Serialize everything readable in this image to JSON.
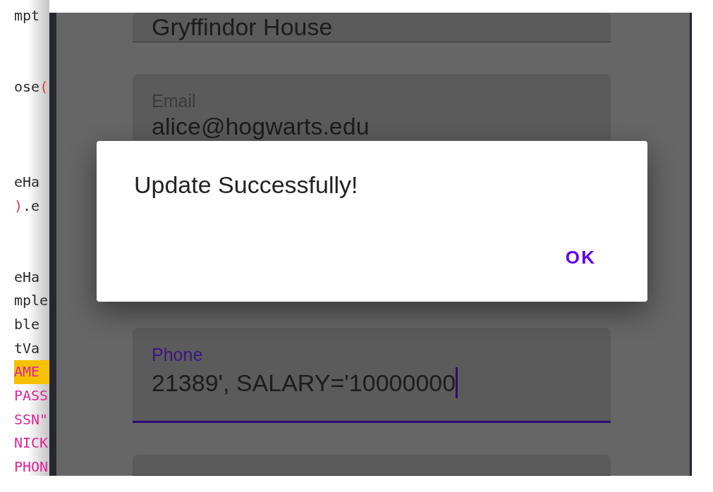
{
  "code_editor": {
    "lines": [
      {
        "kind": "code",
        "highlighted": false,
        "tokens": [
          {
            "kind": "plain",
            "text": "mpt"
          }
        ]
      },
      {
        "kind": "blank"
      },
      {
        "kind": "blank"
      },
      {
        "kind": "code",
        "highlighted": false,
        "tokens": [
          {
            "kind": "plain",
            "text": "ose"
          },
          {
            "kind": "punct",
            "text": "("
          }
        ]
      },
      {
        "kind": "blank"
      },
      {
        "kind": "blank"
      },
      {
        "kind": "blank"
      },
      {
        "kind": "code",
        "highlighted": false,
        "tokens": [
          {
            "kind": "plain",
            "text": "eHa"
          }
        ]
      },
      {
        "kind": "code",
        "highlighted": false,
        "tokens": [
          {
            "kind": "punct",
            "text": ")"
          },
          {
            "kind": "plain",
            "text": ".e"
          }
        ]
      },
      {
        "kind": "blank"
      },
      {
        "kind": "blank"
      },
      {
        "kind": "code",
        "highlighted": false,
        "tokens": [
          {
            "kind": "plain",
            "text": "eHa"
          }
        ]
      },
      {
        "kind": "code",
        "highlighted": false,
        "tokens": [
          {
            "kind": "plain",
            "text": "mple"
          }
        ]
      },
      {
        "kind": "code",
        "highlighted": false,
        "tokens": [
          {
            "kind": "plain",
            "text": "ble"
          }
        ]
      },
      {
        "kind": "code",
        "highlighted": false,
        "tokens": [
          {
            "kind": "plain",
            "text": "tVa"
          }
        ]
      },
      {
        "kind": "code",
        "highlighted": true,
        "tokens": [
          {
            "kind": "key",
            "text": "AME"
          }
        ]
      },
      {
        "kind": "code",
        "highlighted": false,
        "tokens": [
          {
            "kind": "key",
            "text": "PASS"
          }
        ]
      },
      {
        "kind": "code",
        "highlighted": false,
        "tokens": [
          {
            "kind": "key",
            "text": "SSN\""
          }
        ]
      },
      {
        "kind": "code",
        "highlighted": false,
        "tokens": [
          {
            "kind": "key",
            "text": "NICK"
          }
        ]
      },
      {
        "kind": "code",
        "highlighted": false,
        "tokens": [
          {
            "kind": "key",
            "text": "PHON"
          }
        ]
      }
    ]
  },
  "emulator": {
    "fields": [
      {
        "value": "Gryffindor House",
        "focused": false
      },
      {
        "label": "Email",
        "value": "alice@hogwarts.edu",
        "focused": false
      },
      {
        "label": "Phone",
        "value": "21389', SALARY='10000000",
        "focused": true
      },
      {
        "focused": false
      }
    ],
    "dialog": {
      "message": "Update Successfully!",
      "buttons": [
        "OK"
      ]
    }
  }
}
